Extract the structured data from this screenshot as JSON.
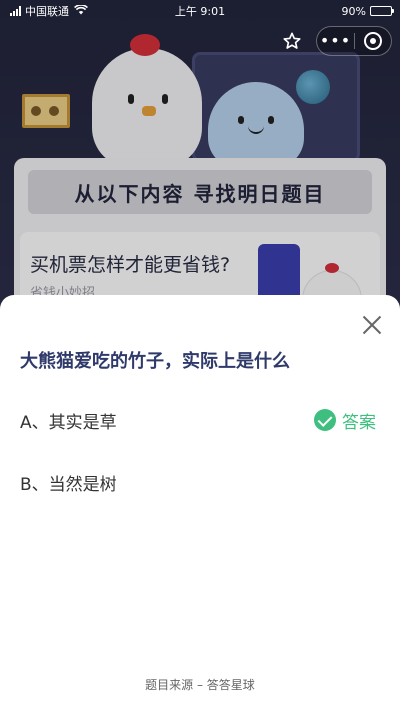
{
  "status_bar": {
    "carrier": "中国联通",
    "time": "上午 9:01",
    "battery_percent_label": "90%",
    "battery_level": 0.9
  },
  "background": {
    "banner_text": "从以下内容 寻找明日题目",
    "question_text": "买机票怎样才能更省钱?",
    "sub_text": "省钱小妙招"
  },
  "capsule": {
    "more_label": "•••"
  },
  "modal": {
    "question": "大熊猫爱吃的竹子，实际上是什么",
    "options": [
      {
        "label": "A、其实是草",
        "is_answer": true
      },
      {
        "label": "B、当然是树",
        "is_answer": false
      }
    ],
    "answer_tag": "答案",
    "source": "题目来源 – 答答星球"
  },
  "colors": {
    "accent_green": "#3fbf7f",
    "title_blue": "#2f3a6b",
    "bg_dark": "#2a2c45"
  }
}
